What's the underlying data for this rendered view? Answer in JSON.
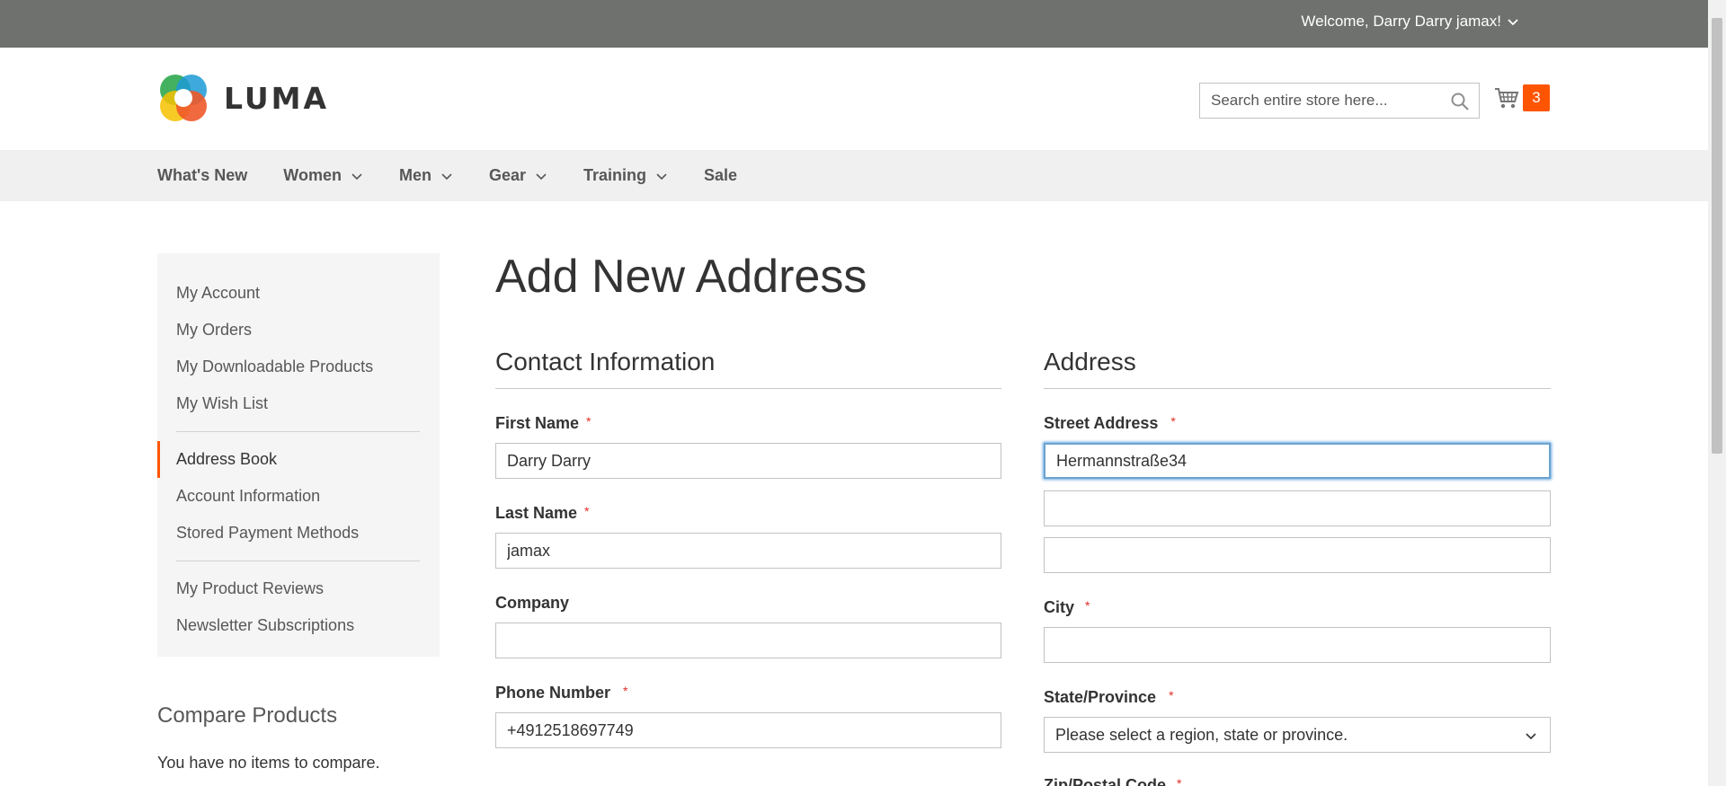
{
  "header": {
    "welcome": "Welcome, Darry Darry jamax!",
    "logo_text": "LUMA",
    "search_placeholder": "Search entire store here...",
    "cart_count": "3"
  },
  "nav": {
    "items": [
      {
        "label": "What's New",
        "has_dropdown": false
      },
      {
        "label": "Women",
        "has_dropdown": true
      },
      {
        "label": "Men",
        "has_dropdown": true
      },
      {
        "label": "Gear",
        "has_dropdown": true
      },
      {
        "label": "Training",
        "has_dropdown": true
      },
      {
        "label": "Sale",
        "has_dropdown": false
      }
    ]
  },
  "sidebar": {
    "group1": [
      "My Account",
      "My Orders",
      "My Downloadable Products",
      "My Wish List"
    ],
    "group2": [
      "Address Book",
      "Account Information",
      "Stored Payment Methods"
    ],
    "group3": [
      "My Product Reviews",
      "Newsletter Subscriptions"
    ],
    "current": "Address Book"
  },
  "compare": {
    "title": "Compare Products",
    "text": "You have no items to compare."
  },
  "page": {
    "title": "Add New Address"
  },
  "contact": {
    "title": "Contact Information",
    "first_name_label": "First Name",
    "first_name_value": "Darry Darry",
    "last_name_label": "Last Name",
    "last_name_value": "jamax",
    "company_label": "Company",
    "company_value": "",
    "phone_label": "Phone Number",
    "phone_value": "+4912518697749"
  },
  "address": {
    "title": "Address",
    "street_label": "Street Address",
    "street_line1": "Hermannstraße34",
    "street_line2": "",
    "street_line3": "",
    "city_label": "City",
    "city_value": "",
    "state_label": "State/Province",
    "state_value": "Please select a region, state or province.",
    "zip_label": "Zip/Postal Code"
  },
  "required_marker": "*",
  "colors": {
    "top_bar": "#6e716e",
    "accent": "#ff5501",
    "nav_bg": "#f0f0f0",
    "sidebar_bg": "#f5f5f5",
    "required": "#e02b27",
    "focus": "#68a8e0"
  }
}
